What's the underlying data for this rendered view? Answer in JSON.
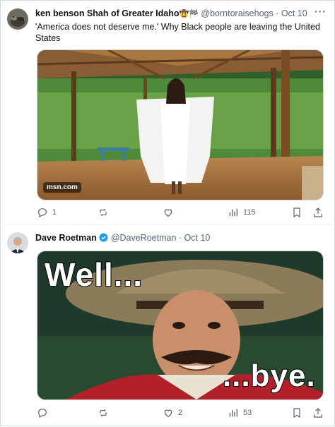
{
  "post1": {
    "author_name": "ken benson Shah of Greater Idaho",
    "author_emoji": "🤠🏁",
    "handle": "@borntoraisehogs",
    "sep": "·",
    "date": "Oct 10",
    "more": "···",
    "text": "'America does not deserve me.' Why Black people are leaving the United States",
    "media_source": "msn.com",
    "actions": {
      "reply": "1",
      "repost": "",
      "like": "",
      "views": "115"
    }
  },
  "post2": {
    "author_name": "Dave Roetman",
    "handle": "@DaveRoetman",
    "sep": "·",
    "date": "Oct 10",
    "meme_top": "Well...",
    "meme_bottom": "...bye.",
    "actions": {
      "reply": "",
      "repost": "",
      "like": "2",
      "views": "53"
    }
  },
  "colors": {
    "text": "#0f1419",
    "muted": "#536471",
    "verified": "#1d9bf0",
    "border": "#cfd9de"
  },
  "icons": [
    "reply-icon",
    "repost-icon",
    "like-icon",
    "views-icon",
    "bookmark-icon",
    "share-icon",
    "verified-badge-icon"
  ]
}
